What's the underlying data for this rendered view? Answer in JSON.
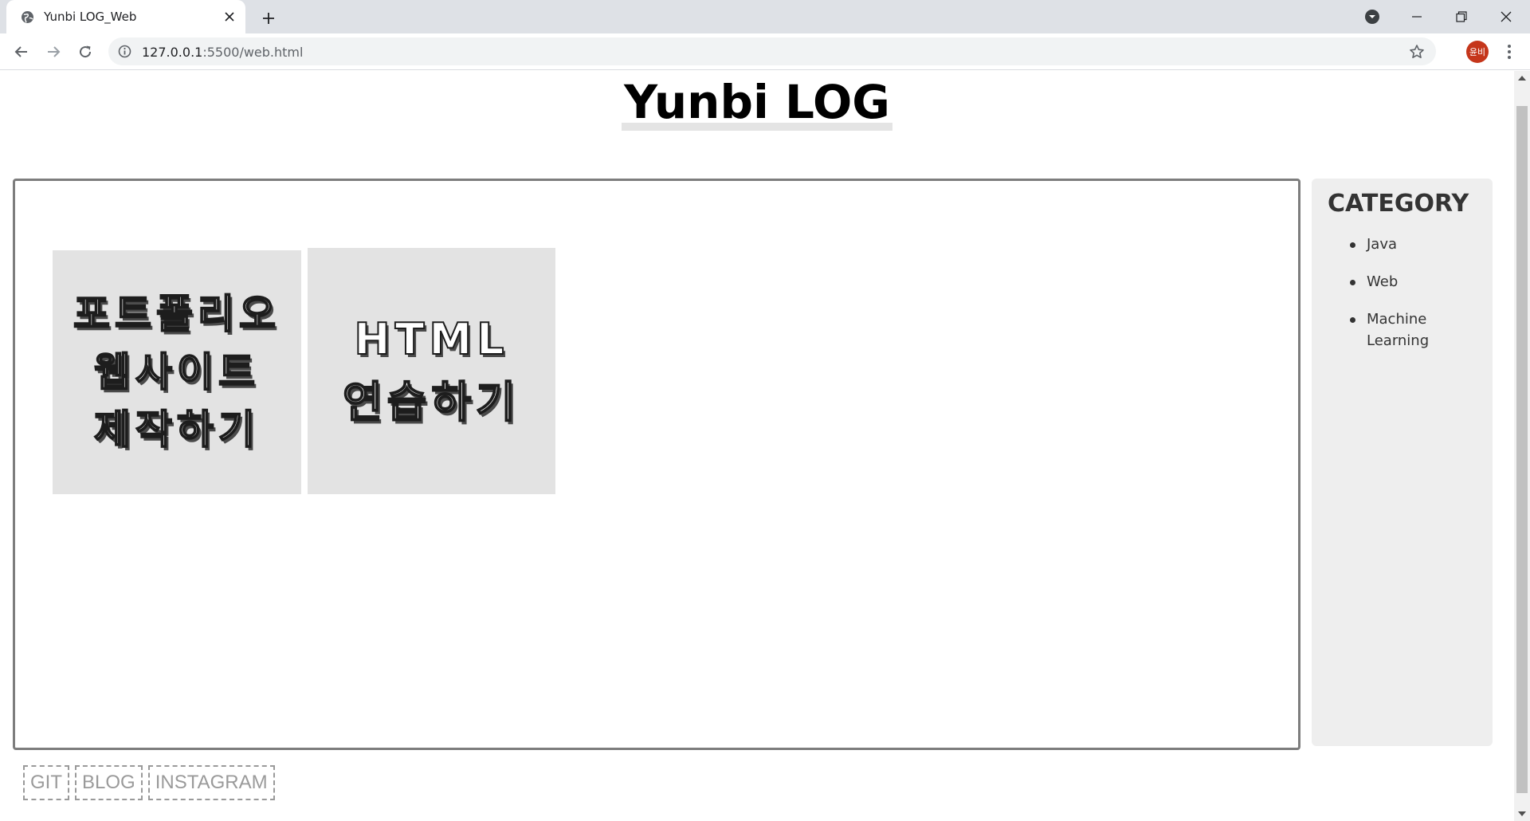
{
  "browser": {
    "tab_title": "Yunbi LOG_Web",
    "url_host": "127.0.0.1",
    "url_path": ":5500/web.html",
    "profile_initials": "윤비",
    "profile_color": "#c5361b"
  },
  "page": {
    "site_title": "Yunbi LOG",
    "posts": [
      {
        "lines": [
          "포트폴리오",
          "웹사이트",
          "제작하기"
        ]
      },
      {
        "lines": [
          "HTML",
          "연습하기"
        ]
      }
    ],
    "sidebar": {
      "heading": "CATEGORY",
      "items": [
        {
          "label": "Java"
        },
        {
          "label": "Web"
        },
        {
          "label": "Machine Learning"
        }
      ]
    },
    "footer_links": [
      {
        "label": "GIT"
      },
      {
        "label": "BLOG"
      },
      {
        "label": "INSTAGRAM"
      }
    ]
  },
  "colors": {
    "tabstrip": "#dee1e6",
    "card_bg": "#e3e3e3",
    "sidebar_bg": "#eeeeee",
    "box_border": "#7d7d7d",
    "footer_link": "#9a9a9a"
  }
}
